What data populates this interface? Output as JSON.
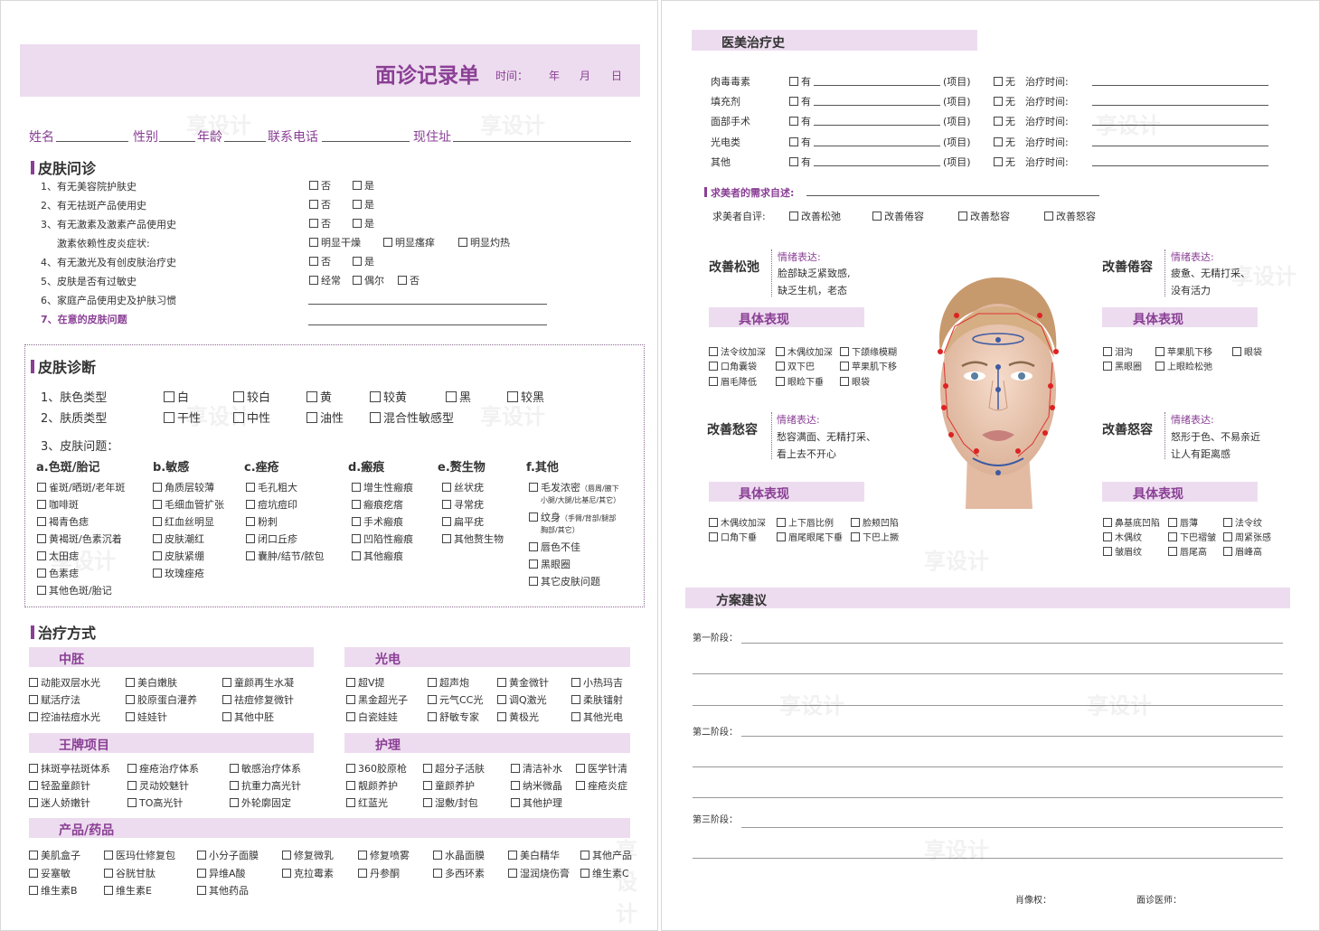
{
  "header": {
    "title": "面诊记录单",
    "time_label": "时间：",
    "year": "年",
    "month": "月",
    "day": "日"
  },
  "info": {
    "name": "姓名",
    "gender": "性别",
    "age": "年龄",
    "phone": "联系电话",
    "address": "现住址"
  },
  "skin_inquiry": {
    "title": "皮肤问诊",
    "items": [
      {
        "q": "1、有无美容院护肤史",
        "opts": [
          "否",
          "是"
        ]
      },
      {
        "q": "2、有无祛斑产品使用史",
        "opts": [
          "否",
          "是"
        ]
      },
      {
        "q": "3、有无激素及激素产品使用史",
        "opts": [
          "否",
          "是"
        ]
      },
      {
        "q": "激素依赖性皮炎症状:",
        "opts": [
          "明显干燥",
          "明显瘙痒",
          "明显灼热"
        ]
      },
      {
        "q": "4、有无激光及有创皮肤治疗史",
        "opts": [
          "否",
          "是"
        ]
      },
      {
        "q": "5、皮肤是否有过敏史",
        "opts": [
          "经常",
          "偶尔",
          "否"
        ]
      },
      {
        "q": "6、家庭产品使用史及护肤习惯",
        "opts": []
      },
      {
        "q": "7、在意的皮肤问题",
        "opts": []
      }
    ]
  },
  "skin_diagnosis": {
    "title": "皮肤诊断",
    "color_label": "1、肤色类型",
    "colors": [
      "白",
      "较白",
      "黄",
      "较黄",
      "黑",
      "较黑"
    ],
    "texture_label": "2、肤质类型",
    "textures": [
      "干性",
      "中性",
      "油性",
      "混合性敏感型"
    ],
    "problem_label": "3、皮肤问题：",
    "columns": [
      {
        "title": "a.色斑/胎记",
        "items": [
          "雀斑/晒斑/老年斑",
          "咖啡斑",
          "褐青色痣",
          "黄褐斑/色素沉着",
          "太田痣",
          "色素痣",
          "其他色斑/胎记"
        ]
      },
      {
        "title": "b.敏感",
        "items": [
          "角质层较薄",
          "毛细血管扩张",
          "红血丝明显",
          "皮肤潮红",
          "皮肤紧绷",
          "玫瑰痤疮"
        ]
      },
      {
        "title": "c.痤疮",
        "items": [
          "毛孔粗大",
          "痘坑痘印",
          "粉刺",
          "闭口丘疹",
          "囊肿/结节/脓包"
        ]
      },
      {
        "title": "d.瘢痕",
        "items": [
          "增生性瘢痕",
          "瘢痕疙瘩",
          "手术瘢痕",
          "凹陷性瘢痕",
          "其他瘢痕"
        ]
      },
      {
        "title": "e.赘生物",
        "items": [
          "丝状疣",
          "寻常疣",
          "扁平疣",
          "其他赘生物"
        ]
      }
    ],
    "other": {
      "title": "f.其他",
      "hair": "毛发浓密",
      "hair_note1": "（唇周/腋下",
      "hair_note2": "小腿/大腿/比基尼/其它）",
      "tattoo": "纹身",
      "tattoo_note1": "（手臂/背部/腿部",
      "tattoo_note2": "胸部/其它）",
      "items": [
        "唇色不佳",
        "黑眼圈",
        "其它皮肤问题"
      ]
    }
  },
  "treatment": {
    "title": "治疗方式",
    "zhongpei": {
      "title": "中胚",
      "rows": [
        [
          "动能双层水光",
          "美白嫩肤",
          "童颜再生水凝"
        ],
        [
          "赋活疗法",
          "胶原蛋白灌养",
          "祛痘修复微针"
        ],
        [
          "控油祛痘水光",
          "娃娃针",
          "其他中胚"
        ]
      ]
    },
    "guangdian": {
      "title": "光电",
      "rows": [
        [
          "超V提",
          "超声炮",
          "黄金微针",
          "小热玛吉"
        ],
        [
          "黑金超光子",
          "元气CC光",
          "调Q激光",
          "柔肤镭射"
        ],
        [
          "白瓷娃娃",
          "舒敏专家",
          "黄极光",
          "其他光电"
        ]
      ]
    },
    "wangpai": {
      "title": "王牌项目",
      "rows": [
        [
          "抹斑亭祛斑体系",
          "痤疮治疗体系",
          "敏感治疗体系"
        ],
        [
          "轻盈童颜针",
          "灵动姣魅针",
          "抗重力高光针"
        ],
        [
          "迷人娇嫩针",
          "TO高光针",
          "外轮廓固定"
        ]
      ]
    },
    "huli": {
      "title": "护理",
      "rows": [
        [
          "360胶原枪",
          "超分子活肤",
          "清洁补水",
          "医学针清"
        ],
        [
          "靓颜养护",
          "童颜养护",
          "纳米微晶",
          "痤疮炎症"
        ],
        [
          "红蓝光",
          "湿敷/封包",
          "其他护理"
        ]
      ]
    },
    "products": {
      "title": "产品/药品",
      "rows": [
        [
          "美肌盒子",
          "医玛仕修复包",
          "小分子面膜",
          "修复微乳",
          "修复喷雾",
          "水晶面膜",
          "美白精华",
          "其他产品"
        ],
        [
          "妥塞敏",
          "谷胱甘肽",
          "异维A酸",
          "克拉霉素",
          "丹参酮",
          "多西环素",
          "湿润烧伤膏",
          "维生素C"
        ],
        [
          "维生素B",
          "维生素E",
          "其他药品"
        ]
      ]
    }
  },
  "history": {
    "title": "医美治疗史",
    "rows": [
      "肉毒毒素",
      "填充剂",
      "面部手术",
      "光电类",
      "其他"
    ],
    "yes": "有",
    "item": "(项目)",
    "no": "无",
    "time": "治疗时间:"
  },
  "needs": {
    "title": "求美者的需求自述:",
    "self_label": "求美者自评:",
    "opts": [
      "改善松弛",
      "改善倦容",
      "改善愁容",
      "改善怒容"
    ]
  },
  "concerns": [
    {
      "title": "改善松弛",
      "emotion_label": "情绪表达:",
      "emotion": [
        "脸部缺乏紧致感,",
        "缺乏生机，老态"
      ],
      "sub": "具体表现",
      "items": [
        [
          "法令纹加深",
          "木偶纹加深",
          "下颌缘模糊"
        ],
        [
          "口角囊袋",
          "双下巴",
          "苹果肌下移"
        ],
        [
          "眉毛降低",
          "眼睑下垂",
          "眼袋"
        ]
      ]
    },
    {
      "title": "改善倦容",
      "emotion_label": "情绪表达:",
      "emotion": [
        "疲惫、无精打采、",
        "没有活力"
      ],
      "sub": "具体表现",
      "items": [
        [
          "泪沟",
          "苹果肌下移",
          "眼袋"
        ],
        [
          "黑眼圈",
          "上眼睑松弛"
        ]
      ]
    },
    {
      "title": "改善愁容",
      "emotion_label": "情绪表达:",
      "emotion": [
        "愁容满面、无精打采、",
        "看上去不开心"
      ],
      "sub": "具体表现",
      "items": [
        [
          "木偶纹加深",
          "上下唇比例",
          "脸颊凹陷"
        ],
        [
          "口角下垂",
          "眉尾眼尾下垂",
          "下巴上撅"
        ]
      ]
    },
    {
      "title": "改善怒容",
      "emotion_label": "情绪表达:",
      "emotion": [
        "怒形于色、不易亲近",
        "让人有距离感"
      ],
      "sub": "具体表现",
      "items": [
        [
          "鼻基底凹陷",
          "唇薄",
          "法令纹"
        ],
        [
          "木偶纹",
          "下巴褶皱",
          "周紧张感"
        ],
        [
          "皱眉纹",
          "唇尾高",
          "眉峰高"
        ]
      ]
    }
  ],
  "plan": {
    "title": "方案建议",
    "stages": [
      "第一阶段：",
      "第二阶段：",
      "第三阶段："
    ]
  },
  "footer": {
    "portrait": "肖像权：",
    "doctor": "面诊医师："
  },
  "watermark": "享设计",
  "colors": {
    "accent": "#8a3f95",
    "band": "#eddcef"
  }
}
